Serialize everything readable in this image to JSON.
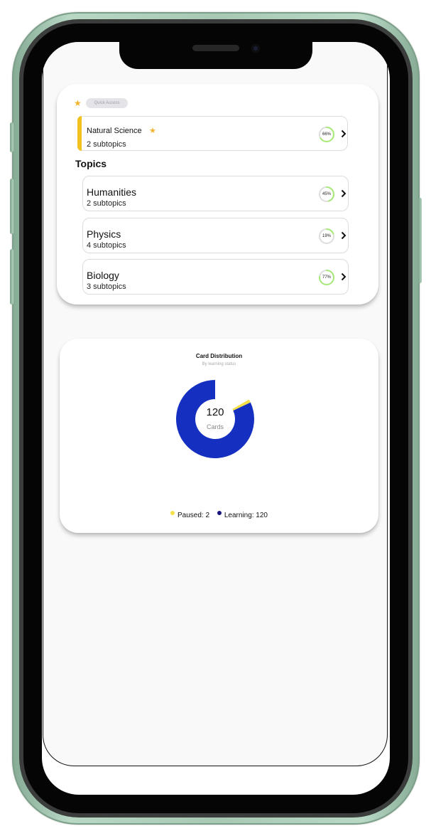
{
  "quick_access": {
    "label": "Quick Access",
    "favorites": [
      {
        "title": "Natural Science",
        "subtitle": "2 subtopics",
        "progress": 66,
        "progress_label": "66%",
        "starred": true
      }
    ]
  },
  "topics": {
    "heading": "Topics",
    "items": [
      {
        "title": "Humanities",
        "subtitle": "2 subtopics",
        "progress": 45,
        "progress_label": "45%"
      },
      {
        "title": "Physics",
        "subtitle": "4 subtopics",
        "progress": 19,
        "progress_label": "19%"
      },
      {
        "title": "Biology",
        "subtitle": "3 subtopics",
        "progress": 77,
        "progress_label": "77%"
      }
    ]
  },
  "distribution": {
    "title": "Card Distribution",
    "subtitle": "By learning status",
    "total": "120",
    "unit": "Cards",
    "legend": [
      {
        "label": "Paused: 2",
        "color": "#f5e04a"
      },
      {
        "label": "Learning: 120",
        "color": "#1a1480"
      }
    ]
  },
  "chart_data": {
    "type": "pie",
    "title": "Card Distribution",
    "subtitle": "By learning status",
    "categories": [
      "Paused",
      "Learning"
    ],
    "values": [
      2,
      120
    ],
    "colors": [
      "#f5e04a",
      "#1530c0"
    ]
  },
  "colors": {
    "accent": "#f1c21f",
    "star": "#f2b32c",
    "progress_ring": "#a8ea7a",
    "progress_track": "#dedede",
    "donut_main": "#1530c0"
  },
  "icons": {
    "star": "star-icon",
    "chevron": "chevron-right-icon"
  }
}
